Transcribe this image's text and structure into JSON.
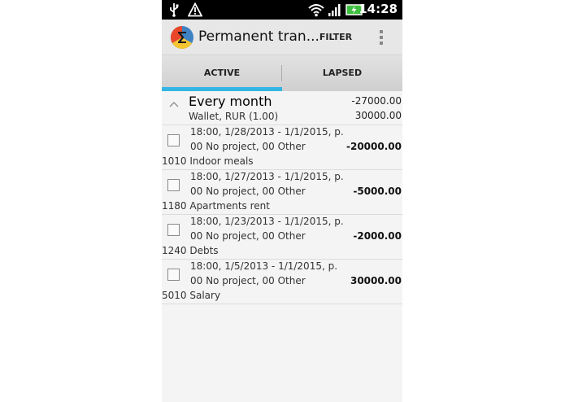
{
  "status_bar": {
    "icons": [
      "usb-icon",
      "warning-icon",
      "wifi-icon",
      "signal-icon",
      "battery-charging-icon"
    ],
    "time": "14:28"
  },
  "action_bar": {
    "title": "Permanent tran...",
    "filter_label": "FILTER",
    "app_icon": "sigma-logo-icon",
    "overflow_icon": "overflow-menu-icon"
  },
  "tabs": [
    {
      "label": "ACTIVE",
      "selected": true
    },
    {
      "label": "LAPSED",
      "selected": false
    }
  ],
  "accent_color": "#33b5e5",
  "group": {
    "title": "Every month",
    "subtitle": "Wallet, RUR (1.00)",
    "expense_total": "-27000.00",
    "income_total": "30000.00",
    "collapse_icon": "chevron-up-icon"
  },
  "items": [
    {
      "line1": "18:00, 1/28/2013 - 1/1/2015, p.",
      "line2": "00 No project, 00 Other",
      "line3": "1010 Indoor meals",
      "amount": "-20000.00"
    },
    {
      "line1": "18:00, 1/27/2013 - 1/1/2015, p.",
      "line2": "00 No project, 00 Other",
      "line3": "1180 Apartments rent",
      "amount": "-5000.00"
    },
    {
      "line1": "18:00, 1/23/2013 - 1/1/2015, p.",
      "line2": "00 No project, 00 Other",
      "line3": "1240 Debts",
      "amount": "-2000.00"
    },
    {
      "line1": "18:00, 1/5/2013 - 1/1/2015, p.",
      "line2": "00 No project, 00 Other",
      "line3": "5010 Salary",
      "amount": "30000.00"
    }
  ]
}
